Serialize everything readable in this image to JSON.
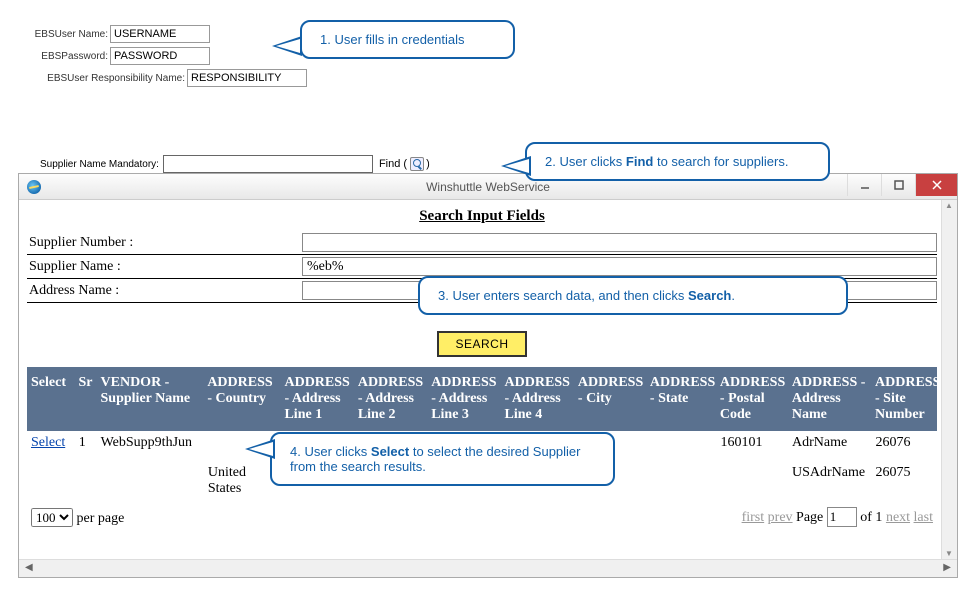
{
  "credentials": {
    "user_label": "EBSUser Name:",
    "user_value": "USERNAME",
    "pass_label": "EBSPassword:",
    "pass_value": "PASSWORD",
    "resp_label": "EBSUser Responsibility Name:",
    "resp_value": "RESPONSIBILITY"
  },
  "supplier_mand_label": "Supplier Name Mandatory:",
  "find_label": "Find ( ",
  "find_close": ")",
  "callouts": {
    "c1": "1. User fills in credentials",
    "c2_pre": "2. User clicks ",
    "c2_bold": "Find",
    "c2_post": " to search for suppliers.",
    "c3_pre": "3. User enters search data, and then clicks ",
    "c3_bold": "Search",
    "c3_post": ".",
    "c4_pre": "4. User clicks ",
    "c4_bold": "Select",
    "c4_post": " to select the desired Supplier from the search results."
  },
  "window": {
    "title": "Winshuttle WebService"
  },
  "form": {
    "heading": "Search Input Fields",
    "supplier_number_label": "Supplier Number :",
    "supplier_name_label": "Supplier Name :",
    "supplier_name_value": "%eb%",
    "address_name_label": "Address Name :"
  },
  "search_button": "SEARCH",
  "grid": {
    "headers": {
      "select": "Select",
      "sr": "Sr",
      "vendor": "VENDOR - Supplier Name",
      "country": "ADDRESS - Country",
      "line1": "ADDRESS - Address Line 1",
      "line2": "ADDRESS - Address Line 2",
      "line3": "ADDRESS - Address Line 3",
      "line4": "ADDRESS - Address Line 4",
      "city": "ADDRESS - City",
      "state": "ADDRESS - State",
      "postal": "ADDRESS - Postal Code",
      "adrname": "ADDRESS - Address Name",
      "sitenum": "ADDRESS - Site Number"
    },
    "rows": [
      {
        "select": "Select",
        "sr": "1",
        "vendor": "WebSupp9thJun",
        "country": "",
        "postal": "160101",
        "adrname": "AdrName",
        "sitenum": "26076"
      },
      {
        "select": "",
        "sr": "",
        "vendor": "",
        "country": "United States",
        "postal": "",
        "adrname": "USAdrName",
        "sitenum": "26075"
      }
    ]
  },
  "pager": {
    "per_page_option": "100",
    "per_page_suffix": "per page",
    "first": "first",
    "prev": "prev",
    "page_label": "Page",
    "page_value": "1",
    "of": "of 1",
    "next": "next",
    "last": "last"
  }
}
